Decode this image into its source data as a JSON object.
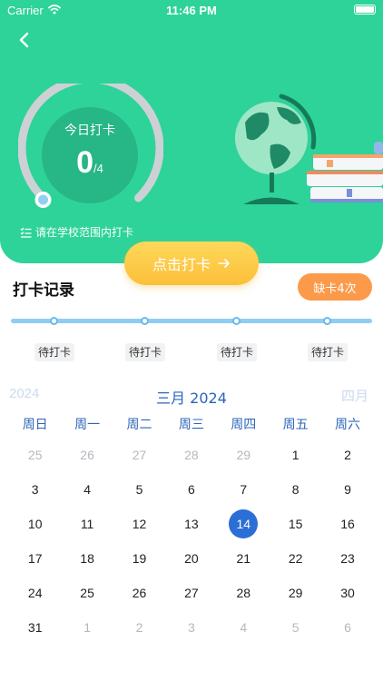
{
  "status": {
    "carrier": "Carrier",
    "time": "11:46 PM"
  },
  "gauge": {
    "title": "今日打卡",
    "count": "0",
    "total": "/4",
    "progress": 0
  },
  "hint": "请在学校范围内打卡",
  "checkin_button": "点击打卡",
  "records": {
    "title": "打卡记录",
    "missing_badge": "缺卡4次",
    "timeline": [
      "待打卡",
      "待打卡",
      "待打卡",
      "待打卡"
    ]
  },
  "calendar": {
    "prev": "2024",
    "current": "三月 2024",
    "next": "四月",
    "weekdays": [
      "周日",
      "周一",
      "周二",
      "周三",
      "周四",
      "周五",
      "周六"
    ],
    "selected": "14",
    "weeks": [
      [
        {
          "d": "25",
          "m": true
        },
        {
          "d": "26",
          "m": true
        },
        {
          "d": "27",
          "m": true
        },
        {
          "d": "28",
          "m": true
        },
        {
          "d": "29",
          "m": true
        },
        {
          "d": "1"
        },
        {
          "d": "2"
        }
      ],
      [
        {
          "d": "3"
        },
        {
          "d": "4"
        },
        {
          "d": "5"
        },
        {
          "d": "6"
        },
        {
          "d": "7"
        },
        {
          "d": "8"
        },
        {
          "d": "9"
        }
      ],
      [
        {
          "d": "10"
        },
        {
          "d": "11"
        },
        {
          "d": "12"
        },
        {
          "d": "13"
        },
        {
          "d": "14",
          "t": true
        },
        {
          "d": "15"
        },
        {
          "d": "16"
        }
      ],
      [
        {
          "d": "17"
        },
        {
          "d": "18"
        },
        {
          "d": "19"
        },
        {
          "d": "20"
        },
        {
          "d": "21"
        },
        {
          "d": "22"
        },
        {
          "d": "23"
        }
      ],
      [
        {
          "d": "24"
        },
        {
          "d": "25"
        },
        {
          "d": "26"
        },
        {
          "d": "27"
        },
        {
          "d": "28"
        },
        {
          "d": "29"
        },
        {
          "d": "30"
        }
      ],
      [
        {
          "d": "31"
        },
        {
          "d": "1",
          "m": true
        },
        {
          "d": "2",
          "m": true
        },
        {
          "d": "3",
          "m": true
        },
        {
          "d": "4",
          "m": true
        },
        {
          "d": "5",
          "m": true
        },
        {
          "d": "6",
          "m": true
        }
      ]
    ]
  },
  "colors": {
    "hero": "#2ed399",
    "accent": "#2b6fd6",
    "badge": "#fb9a4a",
    "button": "#fbbf3a"
  },
  "icons": {
    "back": "chevron-left-icon",
    "hint": "checklist-icon",
    "arrow": "arrow-right-icon"
  }
}
